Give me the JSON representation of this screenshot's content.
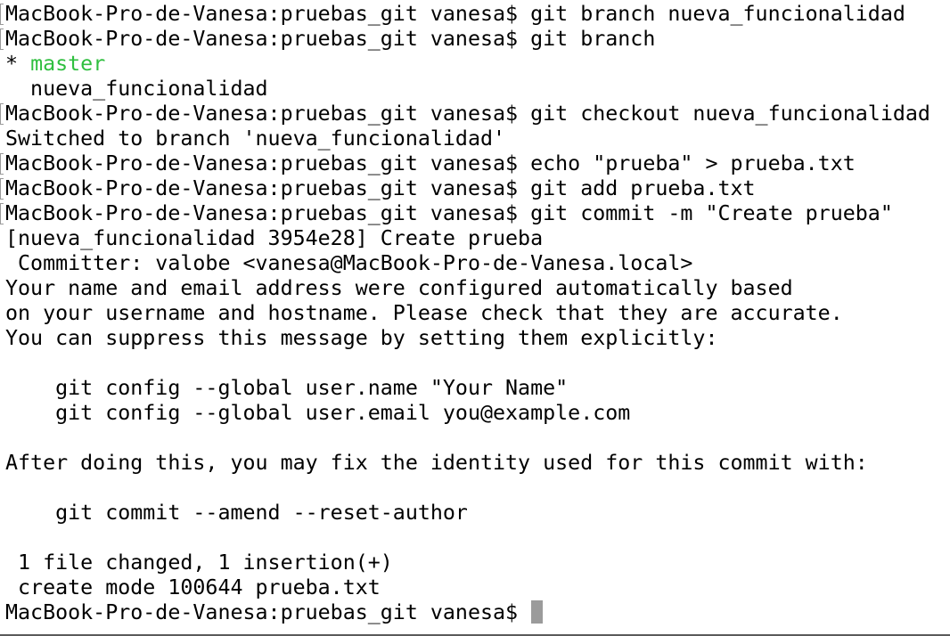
{
  "terminal": {
    "lines": [
      "MacBook-Pro-de-Vanesa:pruebas_git vanesa$ git branch nueva_funcionalidad",
      "MacBook-Pro-de-Vanesa:pruebas_git vanesa$ git branch",
      {
        "prefix": "* ",
        "current_branch": "master"
      },
      "  nueva_funcionalidad",
      "MacBook-Pro-de-Vanesa:pruebas_git vanesa$ git checkout nueva_funcionalidad",
      "Switched to branch 'nueva_funcionalidad'",
      "MacBook-Pro-de-Vanesa:pruebas_git vanesa$ echo \"prueba\" > prueba.txt",
      "MacBook-Pro-de-Vanesa:pruebas_git vanesa$ git add prueba.txt",
      "MacBook-Pro-de-Vanesa:pruebas_git vanesa$ git commit -m \"Create prueba\"",
      "[nueva_funcionalidad 3954e28] Create prueba",
      " Committer: valobe <vanesa@MacBook-Pro-de-Vanesa.local>",
      "Your name and email address were configured automatically based",
      "on your username and hostname. Please check that they are accurate.",
      "You can suppress this message by setting them explicitly:",
      "",
      "    git config --global user.name \"Your Name\"",
      "    git config --global user.email you@example.com",
      "",
      "After doing this, you may fix the identity used for this commit with:",
      "",
      "    git commit --amend --reset-author",
      "",
      " 1 file changed, 1 insertion(+)",
      " create mode 100644 prueba.txt"
    ],
    "prompt": "MacBook-Pro-de-Vanesa:pruebas_git vanesa$ ",
    "colors": {
      "background": "#ffffff",
      "text": "#000000",
      "current_branch": "#2fbf3f",
      "cursor": "#9b9b9b"
    }
  }
}
